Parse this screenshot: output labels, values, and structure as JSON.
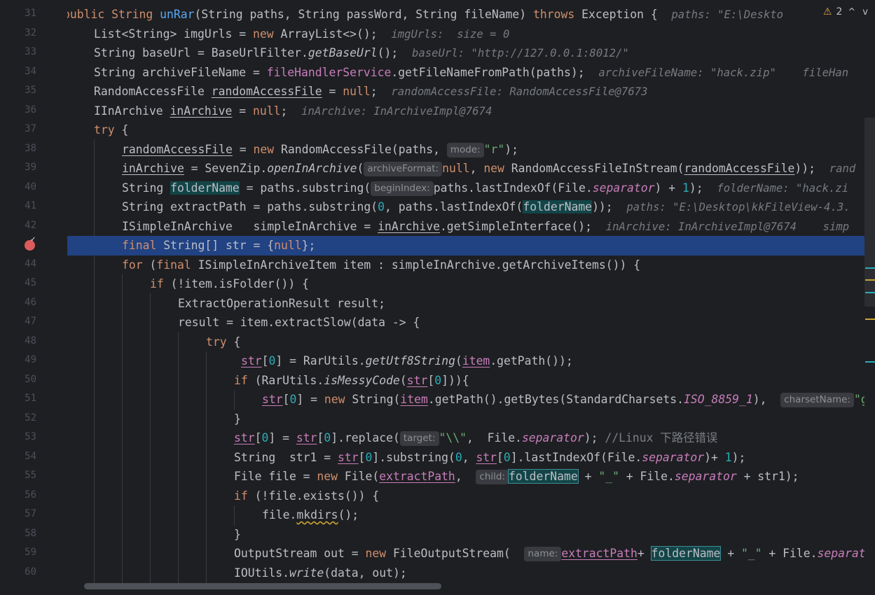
{
  "gutter": {
    "line_numbers": [
      "31",
      "32",
      "33",
      "34",
      "35",
      "36",
      "37",
      "38",
      "39",
      "40",
      "41",
      "42",
      "43",
      "44",
      "45",
      "46",
      "47",
      "48",
      "49",
      "50",
      "51",
      "52",
      "53",
      "54",
      "55",
      "56",
      "57",
      "58",
      "59",
      "60"
    ],
    "breakpoint_line": "43"
  },
  "inspection": {
    "warning_count": "2",
    "up_label": "^",
    "down_label": "v"
  },
  "code": {
    "l31": {
      "t1": "public String ",
      "fn": "unRar",
      "t2": "(String paths, String passWord, String fileName) ",
      "kw": "throws",
      "t3": " Exception {  ",
      "dbg": "paths: \"E:\\Deskto"
    },
    "l32": {
      "t1": "List<String> imgUrls = ",
      "kw": "new",
      "t2": " ArrayList<>();  ",
      "dbg": "imgUrls:  size = 0"
    },
    "l33": {
      "t1": "String baseUrl = BaseUrlFilter.",
      "m": "getBaseUrl",
      "t2": "();  ",
      "dbg": "baseUrl: \"http://127.0.0.1:8012/\""
    },
    "l34": {
      "t1": "String archiveFileName = ",
      "fld": "fileHandlerService",
      "t2": ".getFileNameFromPath(paths);  ",
      "dbg": "archiveFileName: \"hack.zip\"    fileHan"
    },
    "l35": {
      "t1": "RandomAccessFile ",
      "v": "randomAccessFile",
      "t2": " = ",
      "kw": "null",
      "t3": ";  ",
      "dbg": "randomAccessFile: RandomAccessFile@7673"
    },
    "l36": {
      "t1": "IInArchive ",
      "v": "inArchive",
      "t2": " = ",
      "kw": "null",
      "t3": ";  ",
      "dbg": "inArchive: InArchiveImpl@7674"
    },
    "l37": {
      "kw": "try",
      "t1": " {"
    },
    "l38": {
      "v": "randomAccessFile",
      "t1": " = ",
      "kw": "new",
      "t2": " RandomAccessFile(paths, ",
      "hint": "mode:",
      "s": "\"r\"",
      "t3": ");"
    },
    "l39": {
      "v": "inArchive",
      "t1": " = SevenZip.",
      "m": "openInArchive",
      "t2": "(",
      "hint": "archiveFormat:",
      "kw1": "null",
      "t3": ", ",
      "kw2": "new",
      "t4": " RandomAccessFileInStream(",
      "v2": "randomAccessFile",
      "t5": "));  ",
      "dbg": "rand"
    },
    "l40": {
      "t1": "String ",
      "v": "folderName",
      "t2": " = paths.substring(",
      "hint": "beginIndex:",
      "t3": "paths.lastIndexOf(File.",
      "sf": "separator",
      "t4": ") + ",
      "n": "1",
      "t5": ");  ",
      "dbg": "folderName: \"hack.zi"
    },
    "l41": {
      "t1": "String extractPath = paths.substring(",
      "n": "0",
      "t2": ", paths.lastIndexOf(",
      "v": "folderName",
      "t3": "));  ",
      "dbg": "paths: \"E:\\Desktop\\kkFileView-4.3."
    },
    "l42": {
      "t1": "ISimpleInArchive   simpleInArchive = ",
      "v": "inArchive",
      "t2": ".getSimpleInterface();  ",
      "dbg": "inArchive: InArchiveImpl@7674    simp"
    },
    "l43": {
      "kw": "final",
      "t1": " String[] str = {",
      "kw2": "null",
      "t2": "};"
    },
    "l44": {
      "kw": "for",
      "t1": " (",
      "kw2": "final",
      "t2": " ISimpleInArchiveItem item : simpleInArchive.getArchiveItems()) {"
    },
    "l45": {
      "kw": "if",
      "t1": " (!item.isFolder()) {"
    },
    "l46": {
      "t1": "ExtractOperationResult result;"
    },
    "l47": {
      "t1": "result = item.extractSlow(data -> {"
    },
    "l48": {
      "kw": "try",
      "t1": " {"
    },
    "l49": {
      "v": "str",
      "t1": "[",
      "n": "0",
      "t2": "] = RarUtils.",
      "m": "getUtf8String",
      "t3": "(",
      "v2": "item",
      "t4": ".getPath());"
    },
    "l50": {
      "kw": "if",
      "t1": " (RarUtils.",
      "m": "isMessyCode",
      "t2": "(",
      "v": "str",
      "t3": "[",
      "n": "0",
      "t4": "])){"
    },
    "l51": {
      "v": "str",
      "t1": "[",
      "n": "0",
      "t2": "] = ",
      "kw": "new",
      "t3": " String(",
      "v2": "item",
      "t4": ".getPath().getBytes(StandardCharsets.",
      "sf": "ISO_8859_1",
      "t5": "),  ",
      "hint": "charsetName:",
      "s": "\"g"
    },
    "l52": {
      "t1": "}"
    },
    "l53": {
      "v": "str",
      "t1": "[",
      "n": "0",
      "t2": "] = ",
      "v2": "str",
      "t3": "[",
      "n2": "0",
      "t4": "].replace(",
      "hint": "target:",
      "s": "\"\\\\\"",
      "t5": ",  File.",
      "sf": "separator",
      "t6": "); ",
      "c": "//Linux 下路径错误"
    },
    "l54": {
      "t1": "String  str1 = ",
      "v": "str",
      "t2": "[",
      "n": "0",
      "t3": "].substring(",
      "n2": "0",
      "t4": ", ",
      "v2": "str",
      "t5": "[",
      "n3": "0",
      "t6": "].lastIndexOf(File.",
      "sf": "separator",
      "t7": ")+ ",
      "n4": "1",
      "t8": ");"
    },
    "l55": {
      "t1": "File file = ",
      "kw": "new",
      "t2": " File(",
      "v": "extractPath",
      "t3": ",  ",
      "hint": "child:",
      "v2": "folderName",
      "t4": " + ",
      "s": "\"_\"",
      "t5": " + File.",
      "sf": "separator",
      "t6": " + str1);"
    },
    "l56": {
      "kw": "if",
      "t1": " (!file.exists()) {"
    },
    "l57": {
      "t1": "file.",
      "w": "mkdirs",
      "t2": "();"
    },
    "l58": {
      "t1": "}"
    },
    "l59": {
      "t1": "OutputStream out = ",
      "kw": "new",
      "t2": " FileOutputStream(  ",
      "hint": "name:",
      "v": "extractPath",
      "t3": "+ ",
      "v2": "folderName",
      "t4": " + ",
      "s": "\"_\"",
      "t5": " + File.",
      "sf": "separato"
    },
    "l60": {
      "t1": "IOUtils.",
      "m": "write",
      "t2": "(data, out);"
    }
  },
  "colors": {
    "background": "#1e1f22",
    "keyword": "#cf8e6d",
    "function": "#56a8f5",
    "string": "#6aab73",
    "number": "#2aacb8",
    "static_field": "#c77dbb",
    "selection": "#214283",
    "breakpoint": "#db5c5c"
  }
}
